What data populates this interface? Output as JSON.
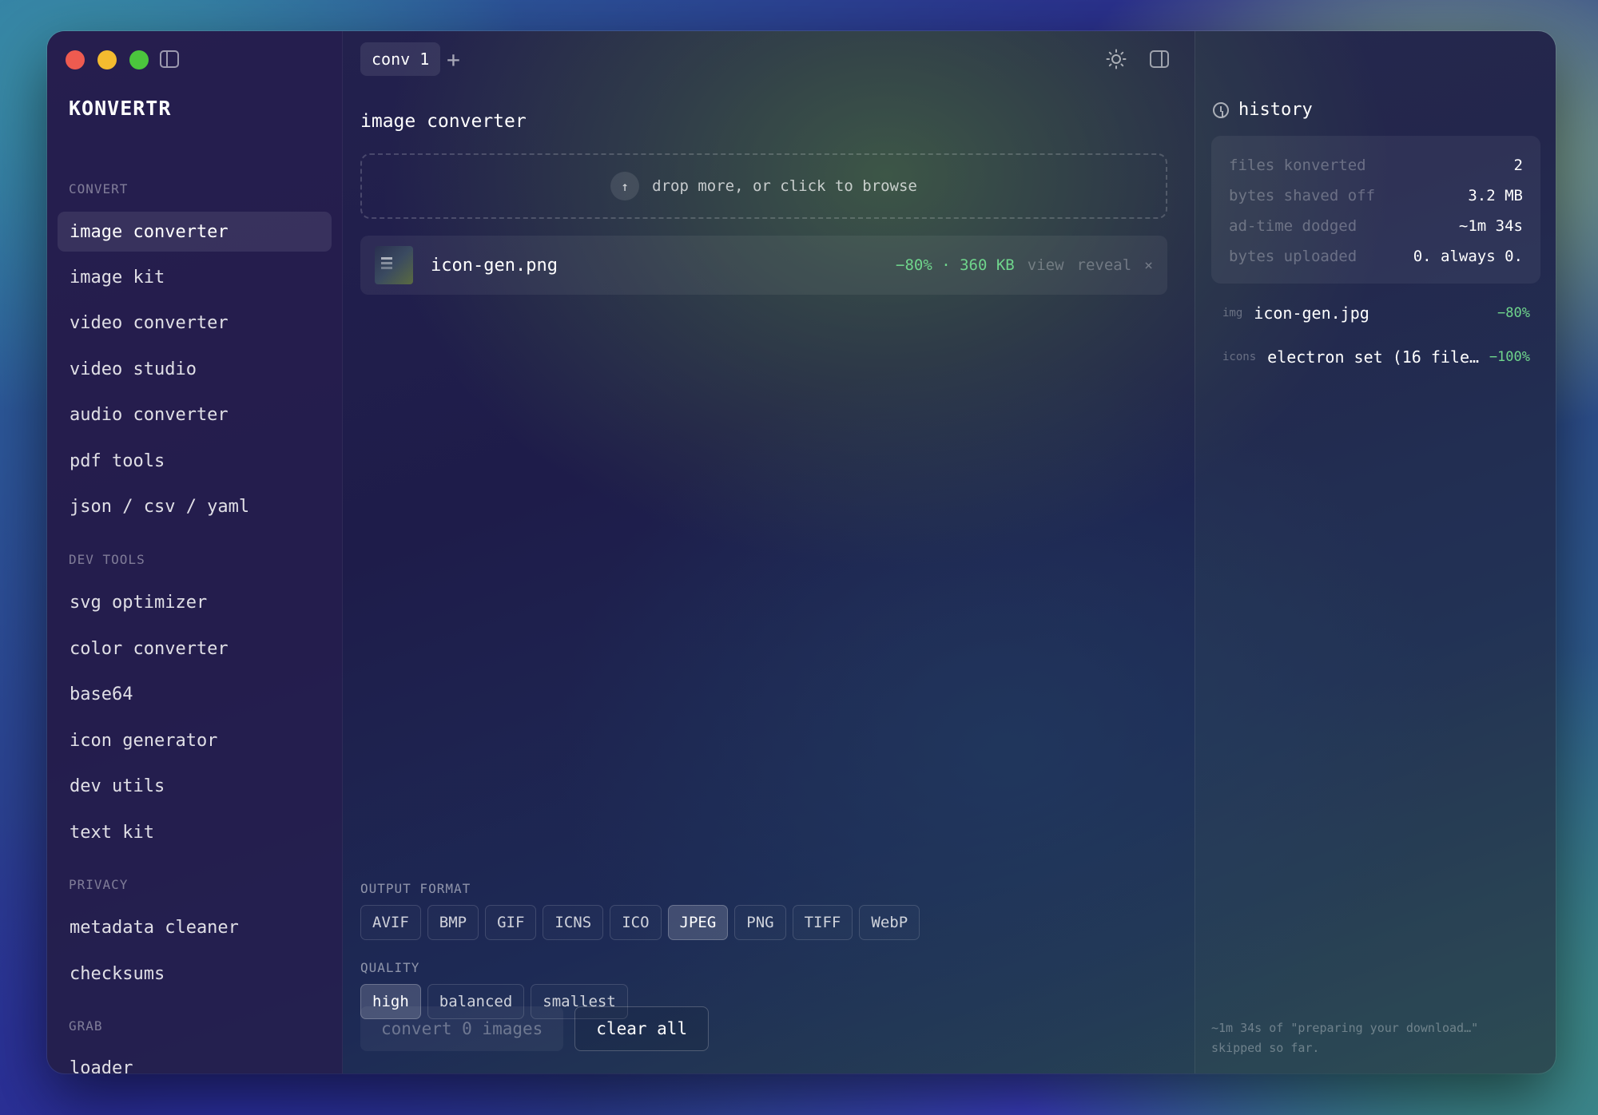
{
  "app": {
    "brand": "KONVERTR"
  },
  "tabs": [
    {
      "label": "conv 1"
    }
  ],
  "tab_add": "+",
  "sidebar": {
    "sections": [
      {
        "title": "CONVERT",
        "items": [
          "image converter",
          "image kit",
          "video converter",
          "video studio",
          "audio converter",
          "pdf tools",
          "json / csv / yaml"
        ]
      },
      {
        "title": "DEV TOOLS",
        "items": [
          "svg optimizer",
          "color converter",
          "base64",
          "icon generator",
          "dev utils",
          "text kit"
        ]
      },
      {
        "title": "PRIVACY",
        "items": [
          "metadata cleaner",
          "checksums"
        ]
      },
      {
        "title": "GRAB",
        "items": [
          "loader"
        ]
      }
    ],
    "active": "image converter"
  },
  "main": {
    "title": "image converter",
    "dropzone": {
      "icon": "↑",
      "text": "drop more, or click to browse"
    },
    "file": {
      "name": "icon-gen.png",
      "stats": "−80% · 360 KB",
      "view": "view",
      "reveal": "reveal",
      "close": "×"
    },
    "output_format": {
      "label": "OUTPUT FORMAT",
      "options": [
        "AVIF",
        "BMP",
        "GIF",
        "ICNS",
        "ICO",
        "JPEG",
        "PNG",
        "TIFF",
        "WebP"
      ],
      "selected": "JPEG"
    },
    "quality": {
      "label": "QUALITY",
      "options": [
        "high",
        "balanced",
        "smallest"
      ],
      "selected": "high"
    },
    "convert_button": "convert 0 images",
    "clear_button": "clear all"
  },
  "history": {
    "title": "history",
    "stats": [
      {
        "label": "files konverted",
        "value": "2"
      },
      {
        "label": "bytes shaved off",
        "value": "3.2 MB"
      },
      {
        "label": "ad-time dodged",
        "value": "~1m 34s"
      },
      {
        "label": "bytes uploaded",
        "value": "0. always 0."
      }
    ],
    "items": [
      {
        "tag": "img",
        "name": "icon-gen.jpg",
        "pct": "−80%"
      },
      {
        "tag": "icons",
        "name": "electron set (16 file…",
        "pct": "−100%"
      }
    ],
    "footnote_line1": "~1m 34s of \"preparing your download…\"",
    "footnote_line2": "skipped so far."
  },
  "colors": {
    "accent_green": "#6fd58c",
    "traffic_red": "#ee5b50",
    "traffic_yellow": "#f4bb2f",
    "traffic_green": "#4bc53d"
  }
}
